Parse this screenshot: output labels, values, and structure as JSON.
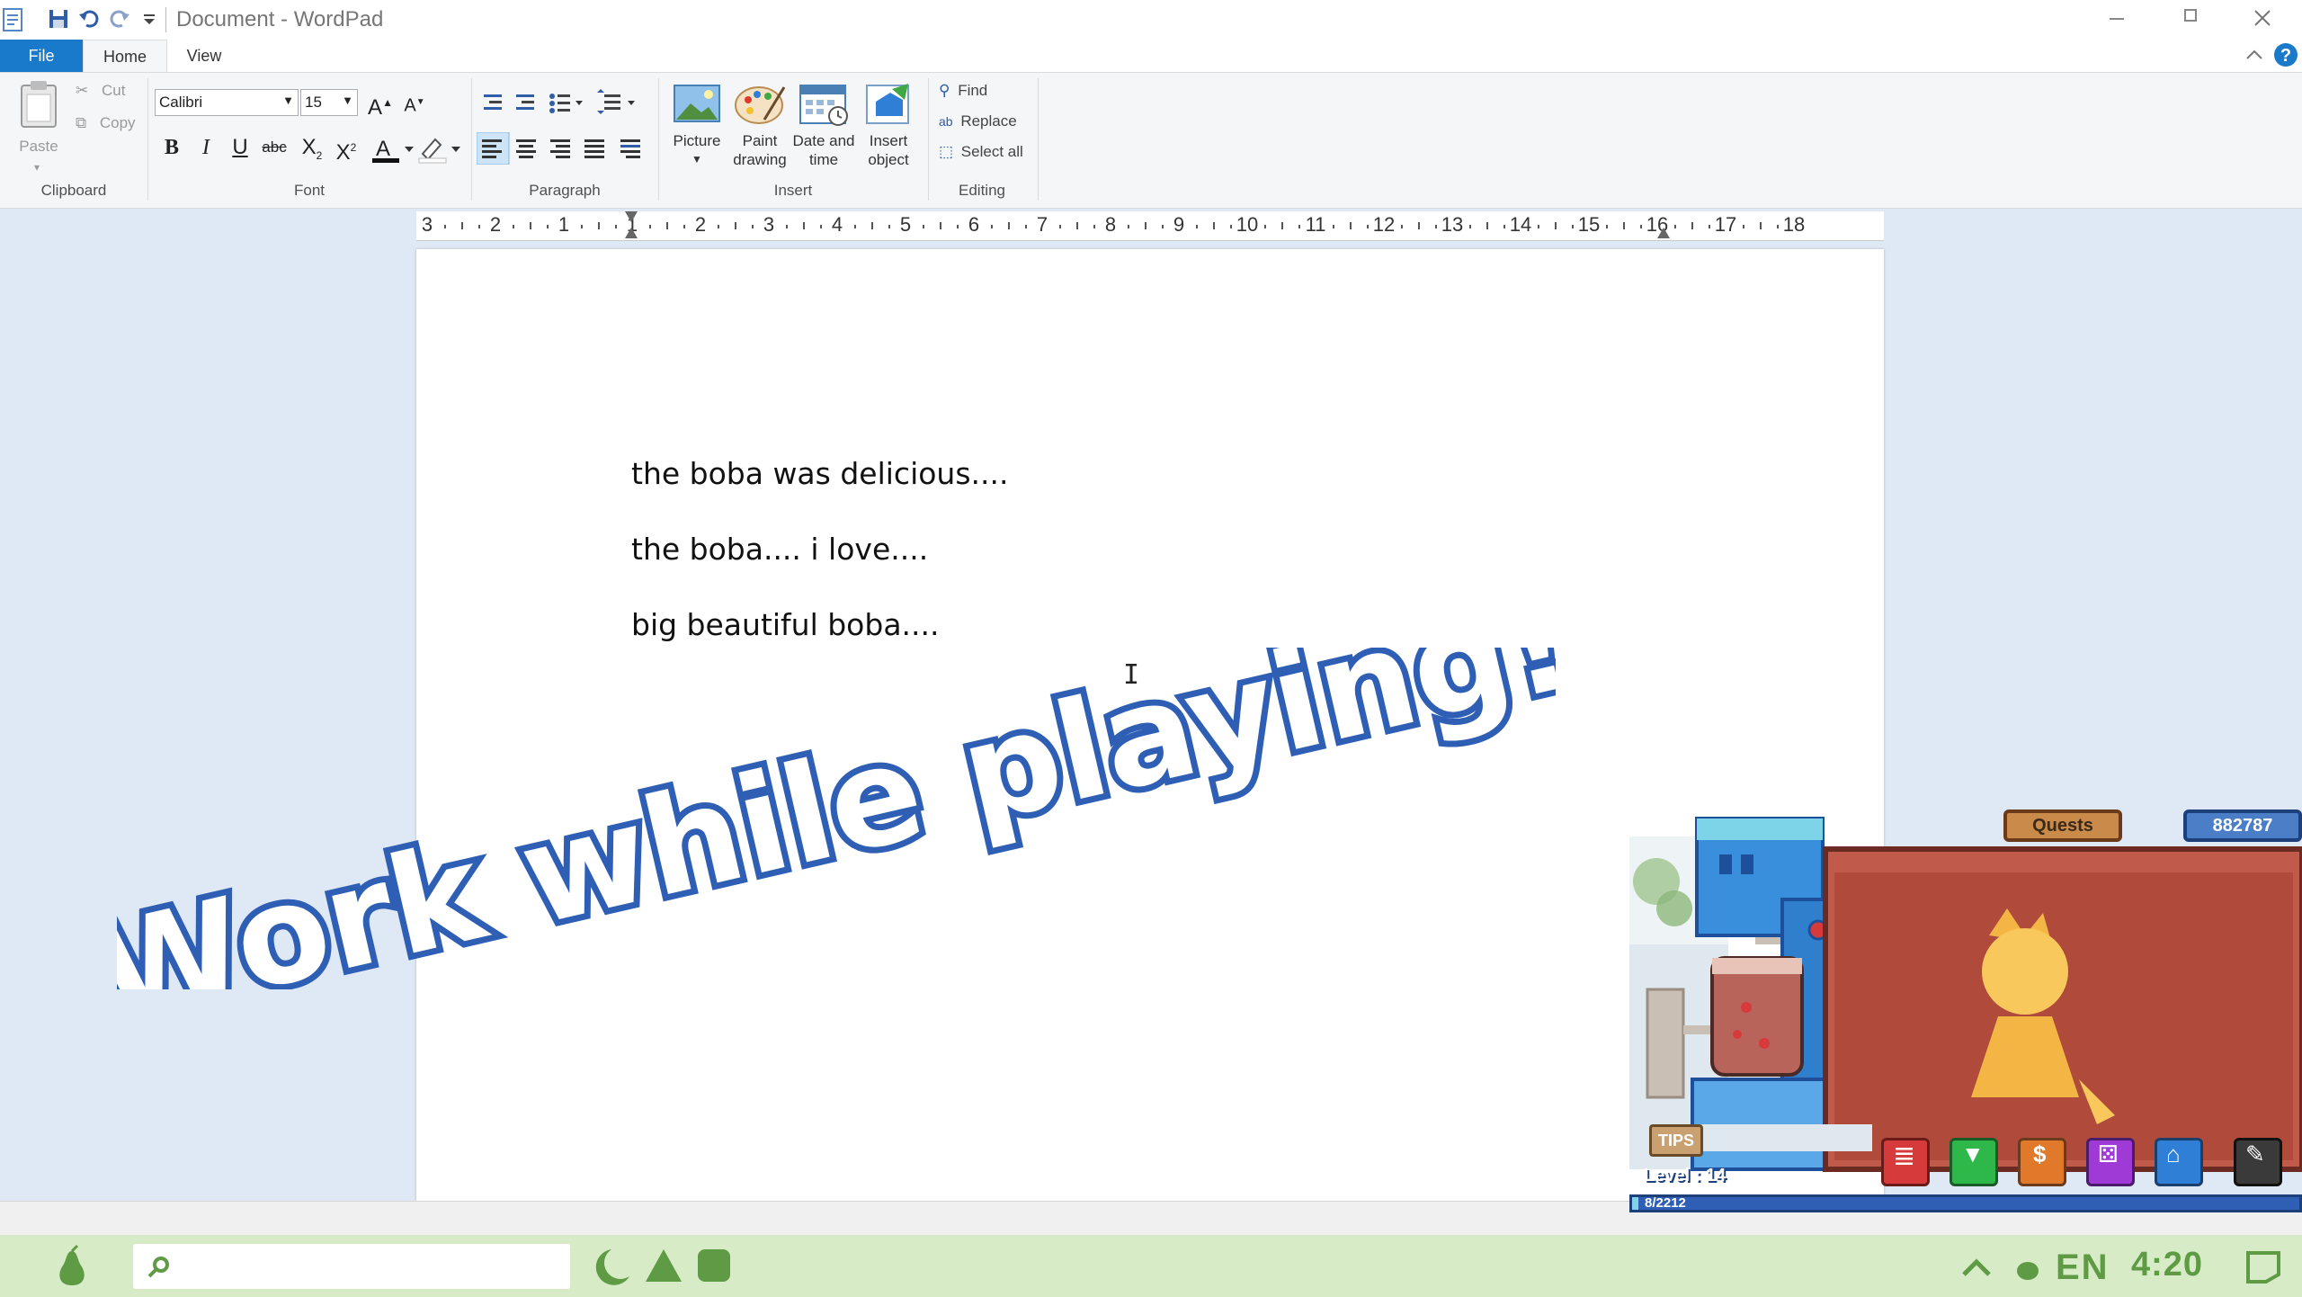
{
  "window": {
    "title": "Document - WordPad"
  },
  "ribbon": {
    "tabs": {
      "file": "File",
      "home": "Home",
      "view": "View"
    },
    "clipboard": {
      "paste": "Paste",
      "cut": "Cut",
      "copy": "Copy",
      "label": "Clipboard"
    },
    "font": {
      "family": "Calibri",
      "size": "15",
      "label": "Font"
    },
    "paragraph": {
      "label": "Paragraph"
    },
    "insert": {
      "picture": "Picture",
      "paint_1": "Paint",
      "paint_2": "drawing",
      "date_1": "Date and",
      "date_2": "time",
      "object_1": "Insert",
      "object_2": "object",
      "label": "Insert"
    },
    "editing": {
      "find": "Find",
      "replace": "Replace",
      "select_all": "Select all",
      "label": "Editing"
    }
  },
  "ruler": {
    "numbers": [
      "3",
      "2",
      "1",
      "1",
      "2",
      "3",
      "4",
      "5",
      "6",
      "7",
      "8",
      "9",
      "10",
      "11",
      "12",
      "13",
      "14",
      "15",
      "16",
      "17",
      "18"
    ]
  },
  "document": {
    "lines": [
      "the boba was delicious....",
      "the boba.... i love....",
      "big beautiful boba...."
    ]
  },
  "promo": {
    "text": "Work while playing!"
  },
  "game": {
    "quests": "Quests",
    "coins": "882787",
    "tips": "TIPS",
    "level": "Level : 14",
    "xp": "8/2212"
  },
  "taskbar": {
    "lang": "EN",
    "time": "4:20"
  },
  "colors": {
    "file_tab": "#1979ca",
    "taskbar": "#d6ebc6",
    "taskbar_icon": "#5f9a45",
    "promo_fill": "#ffffff",
    "promo_stroke": "#2e5fb5"
  }
}
